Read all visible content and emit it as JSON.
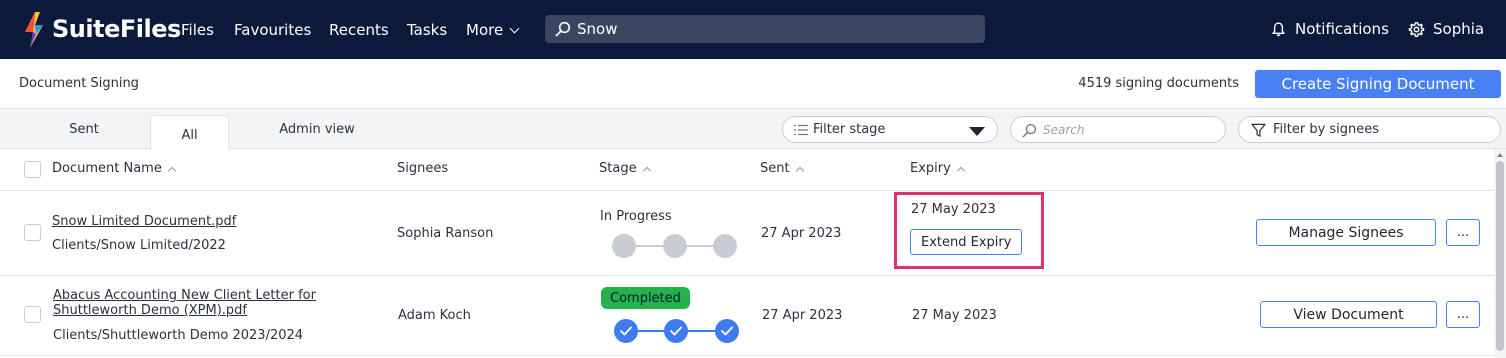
{
  "nav": {
    "brand": "SuiteFiles",
    "links": [
      "Files",
      "Favourites",
      "Recents",
      "Tasks",
      "More"
    ],
    "search_value": "Snow",
    "notifications_label": "Notifications",
    "user_name": "Sophia"
  },
  "header": {
    "title": "Document Signing",
    "count_text": "4519 signing documents",
    "create_label": "Create Signing Document"
  },
  "tabs": [
    {
      "label": "Sent"
    },
    {
      "label": "All",
      "active": true
    },
    {
      "label": "Admin view"
    }
  ],
  "filters": {
    "stage_label": "Filter stage",
    "search_placeholder": "Search",
    "signees_label": "Filter by signees"
  },
  "table": {
    "columns": [
      "Document Name",
      "Signees",
      "Stage",
      "Sent",
      "Expiry"
    ],
    "rows": [
      {
        "name": "Snow Limited Document.pdf",
        "path": "Clients/Snow Limited/2022",
        "signee": "Sophia Ranson",
        "stage": "In Progress",
        "sent": "27 Apr 2023",
        "expiry": "27 May 2023",
        "expiry_action": "Extend Expiry",
        "action": "Manage Signees",
        "more": "..."
      },
      {
        "name_line1": "Abacus Accounting New Client Letter for",
        "name_line2": "Shuttleworth Demo (XPM).pdf",
        "path": "Clients/Shuttleworth Demo 2023/2024",
        "signee": "Adam Koch",
        "stage": "Completed",
        "sent": "27 Apr 2023",
        "expiry": "27 May 2023",
        "action": "View Document",
        "more": "..."
      }
    ]
  },
  "colors": {
    "nav_bg": "#0b1a3b",
    "primary": "#4a80f5",
    "completed": "#23b34a",
    "highlight": "#de2f6f"
  },
  "icons": [
    "suitefiles-logo-icon",
    "search-icon",
    "bell-icon",
    "gear-icon",
    "chevron-down-icon",
    "list-filter-icon",
    "dropdown-triangle-icon",
    "funnel-icon",
    "check-icon"
  ]
}
